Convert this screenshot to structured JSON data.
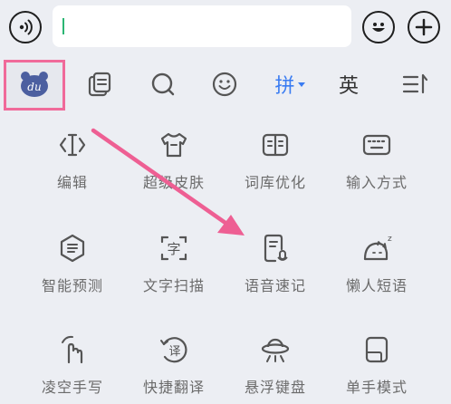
{
  "input_bar": {
    "text_value": ""
  },
  "toolbar": {
    "items": [
      {
        "name": "baidu-du-icon",
        "label": "du"
      },
      {
        "name": "clipboard-icon"
      },
      {
        "name": "search-icon"
      },
      {
        "name": "emoji-icon"
      },
      {
        "name": "pinyin-switch",
        "label": "拼"
      },
      {
        "name": "english-switch",
        "label": "英"
      },
      {
        "name": "more-icon"
      }
    ]
  },
  "grid": {
    "rows": [
      [
        {
          "label": "编辑",
          "icon": "text-cursor-icon"
        },
        {
          "label": "超级皮肤",
          "icon": "tshirt-icon"
        },
        {
          "label": "词库优化",
          "icon": "book-icon"
        },
        {
          "label": "输入方式",
          "icon": "keyboard-icon"
        }
      ],
      [
        {
          "label": "智能预测",
          "icon": "smart-predict-icon"
        },
        {
          "label": "文字扫描",
          "icon": "text-scan-icon"
        },
        {
          "label": "语音速记",
          "icon": "voice-note-icon"
        },
        {
          "label": "懒人短语",
          "icon": "lazy-phrase-icon"
        }
      ],
      [
        {
          "label": "凌空手写",
          "icon": "air-handwriting-icon"
        },
        {
          "label": "快捷翻译",
          "icon": "quick-translate-icon"
        },
        {
          "label": "悬浮键盘",
          "icon": "floating-keyboard-icon"
        },
        {
          "label": "单手模式",
          "icon": "one-hand-icon"
        }
      ]
    ]
  },
  "colors": {
    "background": "#eceef3",
    "accent_blue": "#3a7cf2",
    "highlight_pink": "#f06a9a",
    "icon_gray": "#555555",
    "label_gray": "#6b6b6b"
  }
}
